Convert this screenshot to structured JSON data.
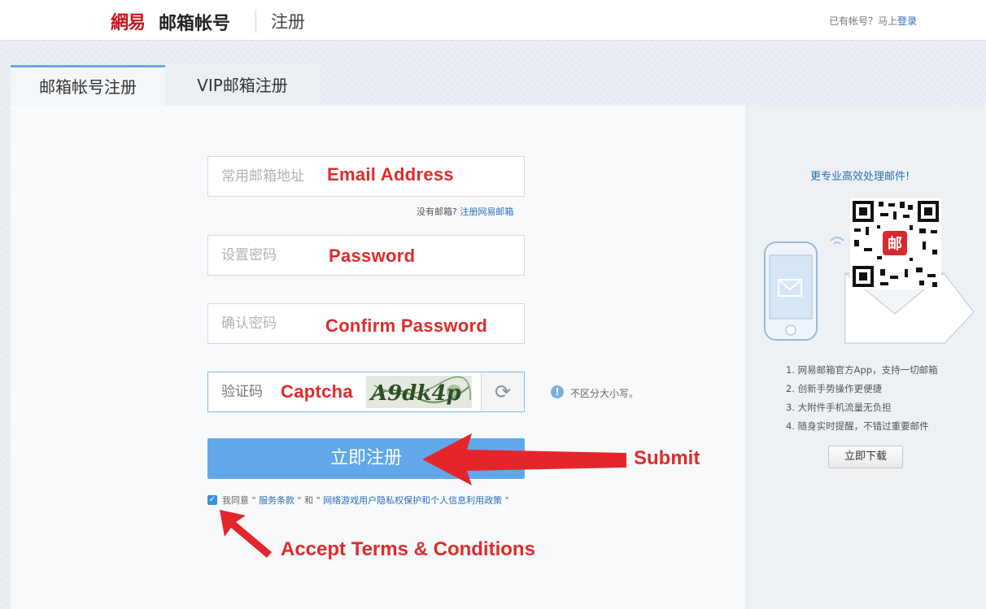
{
  "header": {
    "logo_mark": "網易",
    "logo_text": "邮箱帐号",
    "page_heading": "注册",
    "have_account": "已有帐号？马上",
    "login_link": "登录"
  },
  "tabs": [
    {
      "label": "邮箱帐号注册",
      "active": true
    },
    {
      "label": "VIP邮箱注册",
      "active": false
    }
  ],
  "form": {
    "email_placeholder": "常用邮箱地址",
    "email_note": "Email Address",
    "no_email_text": "没有邮箱?",
    "no_email_link": "注册网易邮箱",
    "password_placeholder": "设置密码",
    "password_note": "Password",
    "confirm_placeholder": "确认密码",
    "confirm_note": "Confirm Password",
    "captcha_placeholder": "验证码",
    "captcha_note": "Captcha",
    "captcha_text": "A9dk4p",
    "captcha_hint": "不区分大小写。",
    "submit_label": "立即注册",
    "agree_checked": true,
    "agree_prefix": "我同意",
    "agree_terms": "服务条款",
    "agree_and": "和",
    "agree_privacy": "网络游戏用户隐私权保护和个人信息利用政策"
  },
  "annotations": {
    "submit": "Submit",
    "terms": "Accept Terms & Conditions"
  },
  "sidebar": {
    "title": "更专业高效处理邮件!",
    "qr_badge": "邮",
    "features": [
      "1. 网易邮箱官方App，支持一切邮箱",
      "2. 创新手势操作更便捷",
      "3. 大附件手机流量无负担",
      "4. 随身实时提醒，不错过重要邮件"
    ],
    "download_label": "立即下载"
  },
  "colors": {
    "brand_red": "#c8161d",
    "link_blue": "#2a6eb8",
    "submit_blue": "#60a8ea",
    "annotation_red": "#e12a2a"
  }
}
